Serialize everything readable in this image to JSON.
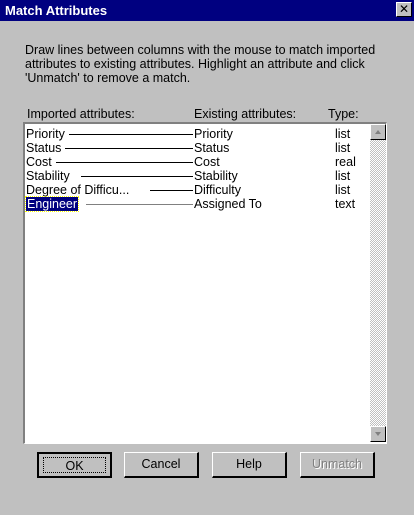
{
  "window": {
    "title": "Match Attributes",
    "close_glyph": "✕"
  },
  "instructions": "Draw lines between columns with the mouse to match imported attributes to existing attributes. Highlight an attribute and click 'Unmatch' to remove a match.",
  "columns": {
    "imported": "Imported attributes:",
    "existing": "Existing attributes:",
    "type": "Type:"
  },
  "rows": [
    {
      "imported": "Priority",
      "existing": "Priority",
      "type": "list"
    },
    {
      "imported": "Status",
      "existing": "Status",
      "type": "list"
    },
    {
      "imported": "Cost",
      "existing": "Cost",
      "type": "real"
    },
    {
      "imported": "Stability",
      "existing": "Stability",
      "type": "list"
    },
    {
      "imported": "Degree of Difficu...",
      "existing": "Difficulty",
      "type": "list"
    },
    {
      "imported": "Engineer",
      "existing": "Assigned To",
      "type": "text"
    }
  ],
  "buttons": {
    "ok": "OK",
    "cancel": "Cancel",
    "help": "Help",
    "unmatch": "Unmatch"
  }
}
